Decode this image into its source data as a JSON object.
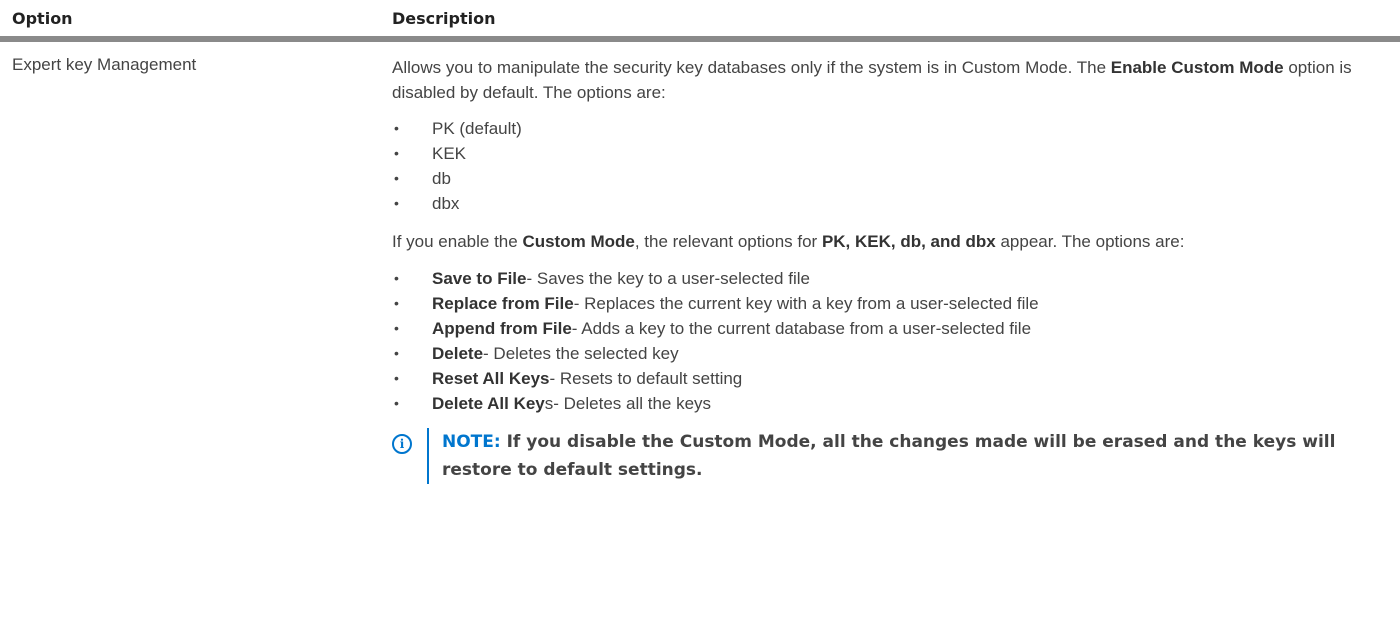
{
  "header": {
    "col_option": "Option",
    "col_description": "Description"
  },
  "row": {
    "option": "Expert key Management",
    "intro": {
      "part1": "Allows you to manipulate the security key databases only if the system is in Custom Mode. The ",
      "bold1": "Enable Custom Mode",
      "part2": " option is disabled by default. The options are:"
    },
    "keys": [
      "PK (default)",
      "KEK",
      "db",
      "dbx"
    ],
    "custom": {
      "part1": "If you enable the ",
      "bold1": "Custom Mode",
      "part2": ", the relevant options for ",
      "bold2": "PK, KEK, db, and dbx",
      "part3": " appear. The options are:"
    },
    "actions": [
      {
        "name": "Save to File",
        "desc": "- Saves the key to a user-selected file"
      },
      {
        "name": "Replace from File",
        "desc": "- Replaces the current key with a key from a user-selected file"
      },
      {
        "name": "Append from File",
        "desc": "- Adds a key to the current database from a user-selected file"
      },
      {
        "name": "Delete",
        "desc": "- Deletes the selected key"
      },
      {
        "name": "Reset All Keys",
        "desc": "- Resets to default setting"
      },
      {
        "name": "Delete All Key",
        "desc": "s- Deletes all the keys"
      }
    ],
    "bullet_char": "•",
    "note": {
      "icon": "i",
      "label": "NOTE:",
      "text": " If you disable the Custom Mode, all the changes made will be erased and the keys will restore to default settings."
    }
  },
  "colors": {
    "accent": "#0076ce",
    "header_rule": "#8a8a8a",
    "text": "#444444"
  }
}
